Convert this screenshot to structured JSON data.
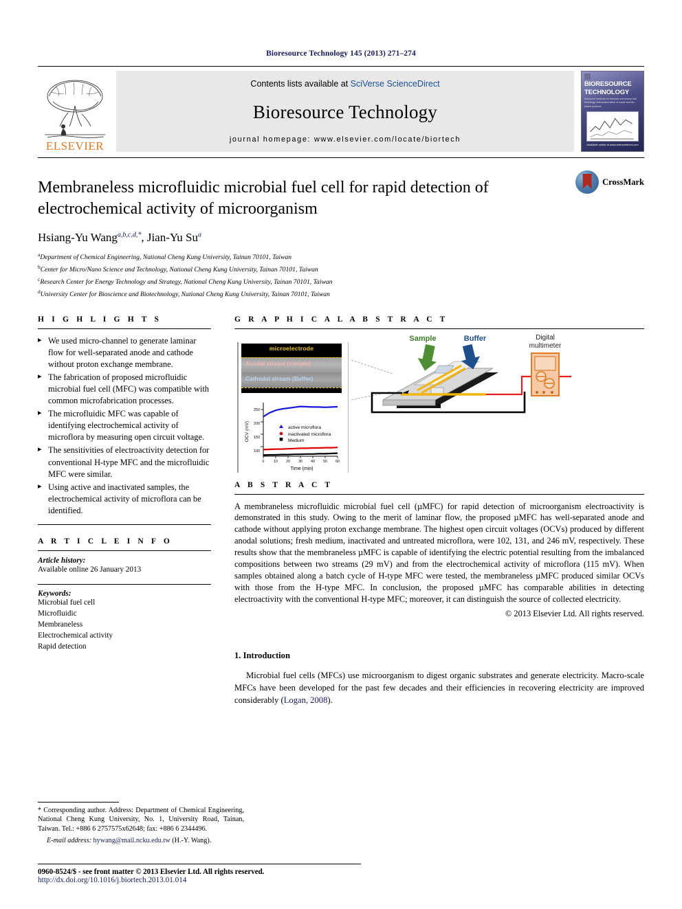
{
  "running_head": "Bioresource Technology 145 (2013) 271–274",
  "masthead": {
    "contents_prefix": "Contents lists available at ",
    "contents_link": "SciVerse ScienceDirect",
    "journal_name": "Bioresource Technology",
    "homepage": "journal homepage: www.elsevier.com/locate/biortech",
    "publisher": "ELSEVIER",
    "cover_title_line1": "BIORESOURCE",
    "cover_title_line2": "TECHNOLOGY",
    "cover_sub": "Advanced methods for biomass conversion and bioenergy, biotransformation of waste and bio-based products",
    "cover_caption": "Available online at www.sciencedirect.com"
  },
  "article": {
    "title": "Membraneless microfluidic microbial fuel cell for rapid detection of electrochemical activity of microorganism",
    "authors_plain": "Hsiang-Yu Wang",
    "author1_sup": "a,b,c,d,",
    "author1_star": "*",
    "author2": ", Jian-Yu Su",
    "author2_sup": "a",
    "affiliations": [
      {
        "mark": "a",
        "text": "Department of Chemical Engineering, National Cheng Kung University, Tainan 70101, Taiwan"
      },
      {
        "mark": "b",
        "text": "Center for Micro/Nano Science and Technology, National Cheng Kung University, Tainan 70101, Taiwan"
      },
      {
        "mark": "c",
        "text": "Research Center for Energy Technology and Strategy, National Cheng Kung University, Tainan 70101, Taiwan"
      },
      {
        "mark": "d",
        "text": "University Center for Bioscience and Biotechnology, National Cheng Kung University, Tainan 70101, Taiwan"
      }
    ],
    "crossmark_label": "CrossMark"
  },
  "highlights": {
    "heading": "H I G H L I G H T S",
    "items": [
      "We used micro-channel to generate laminar flow for well-separated anode and cathode without proton exchange membrane.",
      "The fabrication of proposed microfluidic microbial fuel cell (MFC) was compatible with common microfabrication processes.",
      "The microfluidic MFC was capable of identifying electrochemical activity of microflora by measuring open circuit voltage.",
      "The sensitivities of electroactivity detection for conventional H-type MFC and the microfluidic MFC were similar.",
      "Using active and inactivated samples, the electrochemical activity of microflora can be identified."
    ]
  },
  "article_info": {
    "heading": "A R T I C L E   I N F O",
    "history_label": "Article history:",
    "history_value": "Available online 26 January 2013",
    "keywords_label": "Keywords:",
    "keywords": [
      "Microbial fuel cell",
      "Microfluidic",
      "Membraneless",
      "Electrochemical activity",
      "Rapid detection"
    ]
  },
  "graphical_abstract": {
    "heading": "G R A P H I C A L   A B S T R A C T",
    "micrograph": {
      "top_label": "microelectrode",
      "anodal_label": "Anodal stream (sample)",
      "cathodal_label": "Cathodal stream (Buffer)"
    },
    "diagram": {
      "sample_label": "Sample",
      "buffer_label": "Buffer",
      "multimeter_label_line1": "Digital",
      "multimeter_label_line2": "multimeter",
      "sample_color": "#4f8f34",
      "buffer_color": "#1f4e8c",
      "wire_red": "#e81e1e",
      "wire_black": "#000000"
    }
  },
  "chart_data": {
    "type": "line",
    "title": "",
    "xlabel": "Time (min)",
    "ylabel": "OCV (mV)",
    "xlim": [
      0,
      60
    ],
    "ylim": [
      80,
      275
    ],
    "xticks": [
      0,
      10,
      20,
      30,
      40,
      50,
      60
    ],
    "yticks": [
      100,
      150,
      200,
      250
    ],
    "grid": false,
    "legend_position": "center",
    "x": [
      0,
      5,
      10,
      15,
      20,
      25,
      30,
      35,
      40,
      45,
      50,
      55,
      60
    ],
    "series": [
      {
        "name": "active microflora",
        "color": "#1717d8",
        "marker": "triangle",
        "values": [
          224,
          238,
          247,
          252,
          255,
          258,
          261,
          260,
          259,
          259,
          258,
          259,
          260
        ]
      },
      {
        "name": "inactivated microflora",
        "color": "#e00000",
        "marker": "circle",
        "values": [
          104,
          105,
          106,
          106,
          107,
          108,
          109,
          109,
          110,
          110,
          111,
          111,
          112
        ]
      },
      {
        "name": "Medium",
        "color": "#000000",
        "marker": "square",
        "values": [
          84,
          85,
          85,
          86,
          86,
          87,
          87,
          88,
          88,
          89,
          89,
          90,
          91
        ]
      }
    ]
  },
  "abstract": {
    "heading": "A B S T R A C T",
    "text": "A membraneless microfluidic microbial fuel cell (µMFC) for rapid detection of microorganism electroactivity is demonstrated in this study. Owing to the merit of laminar flow, the proposed µMFC has well-separated anode and cathode without applying proton exchange membrane. The highest open circuit voltages (OCVs) produced by different anodal solutions; fresh medium, inactivated and untreated microflora, were 102, 131, and 246 mV, respectively. These results show that the membraneless µMFC is capable of identifying the electric potential resulting from the imbalanced compositions between two streams (29 mV) and from the electrochemical activity of microflora (115 mV). When samples obtained along a batch cycle of H-type MFC were tested, the membraneless µMFC produced similar OCVs with those from the H-type MFC. In conclusion, the proposed µMFC has comparable abilities in detecting electroactivity with the conventional H-type MFC; moreover, it can distinguish the source of collected electricity.",
    "copyright": "© 2013 Elsevier Ltd. All rights reserved."
  },
  "introduction": {
    "heading": "1. Introduction",
    "paragraph_before_link": "Microbial fuel cells (MFCs) use microorganism to digest organic substrates and generate electricity. Macro-scale MFCs have been developed for the past few decades and their efficiencies in recovering electricity are improved considerably (",
    "citation": "Logan, 2008",
    "paragraph_after_link": ")."
  },
  "footnote": {
    "star": "*",
    "text": " Corresponding author. Address: Department of Chemical Engineering, National Cheng Kung University, No. 1, University Road, Tainan, Taiwan. Tel.: +886 6 2757575x62648; fax: +886 6 2344496.",
    "email_label": "E-mail address:",
    "email": "hywang@mail.ncku.edu.tw",
    "email_suffix": " (H.-Y. Wang)."
  },
  "colophon": {
    "line1": "0960-8524/$ - see front matter © 2013 Elsevier Ltd. All rights reserved.",
    "line2": "http://dx.doi.org/10.1016/j.biortech.2013.01.014"
  }
}
